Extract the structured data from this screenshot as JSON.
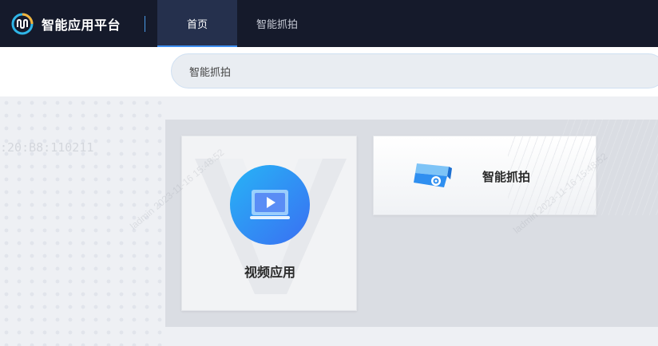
{
  "header": {
    "app_title": "智能应用平台",
    "logo_icon": "platform-logo-icon",
    "tabs": [
      {
        "label": "首页",
        "active": true
      },
      {
        "label": "智能抓拍",
        "active": false
      }
    ],
    "background_color": "#151a2b",
    "active_tab_color": "#25304d",
    "accent_color": "#3d8ef0"
  },
  "search": {
    "value": "智能抓拍"
  },
  "background": {
    "mac_text": ":20:B8:110211"
  },
  "watermark": {
    "text": "ladmin 2023-11-16 15:48:52"
  },
  "apps": [
    {
      "label": "视频应用",
      "icon": "video-monitor-icon",
      "color_start": "#27b4f6",
      "color_end": "#3a6ff2"
    },
    {
      "label": "智能抓拍",
      "icon": "camera-icon"
    }
  ]
}
